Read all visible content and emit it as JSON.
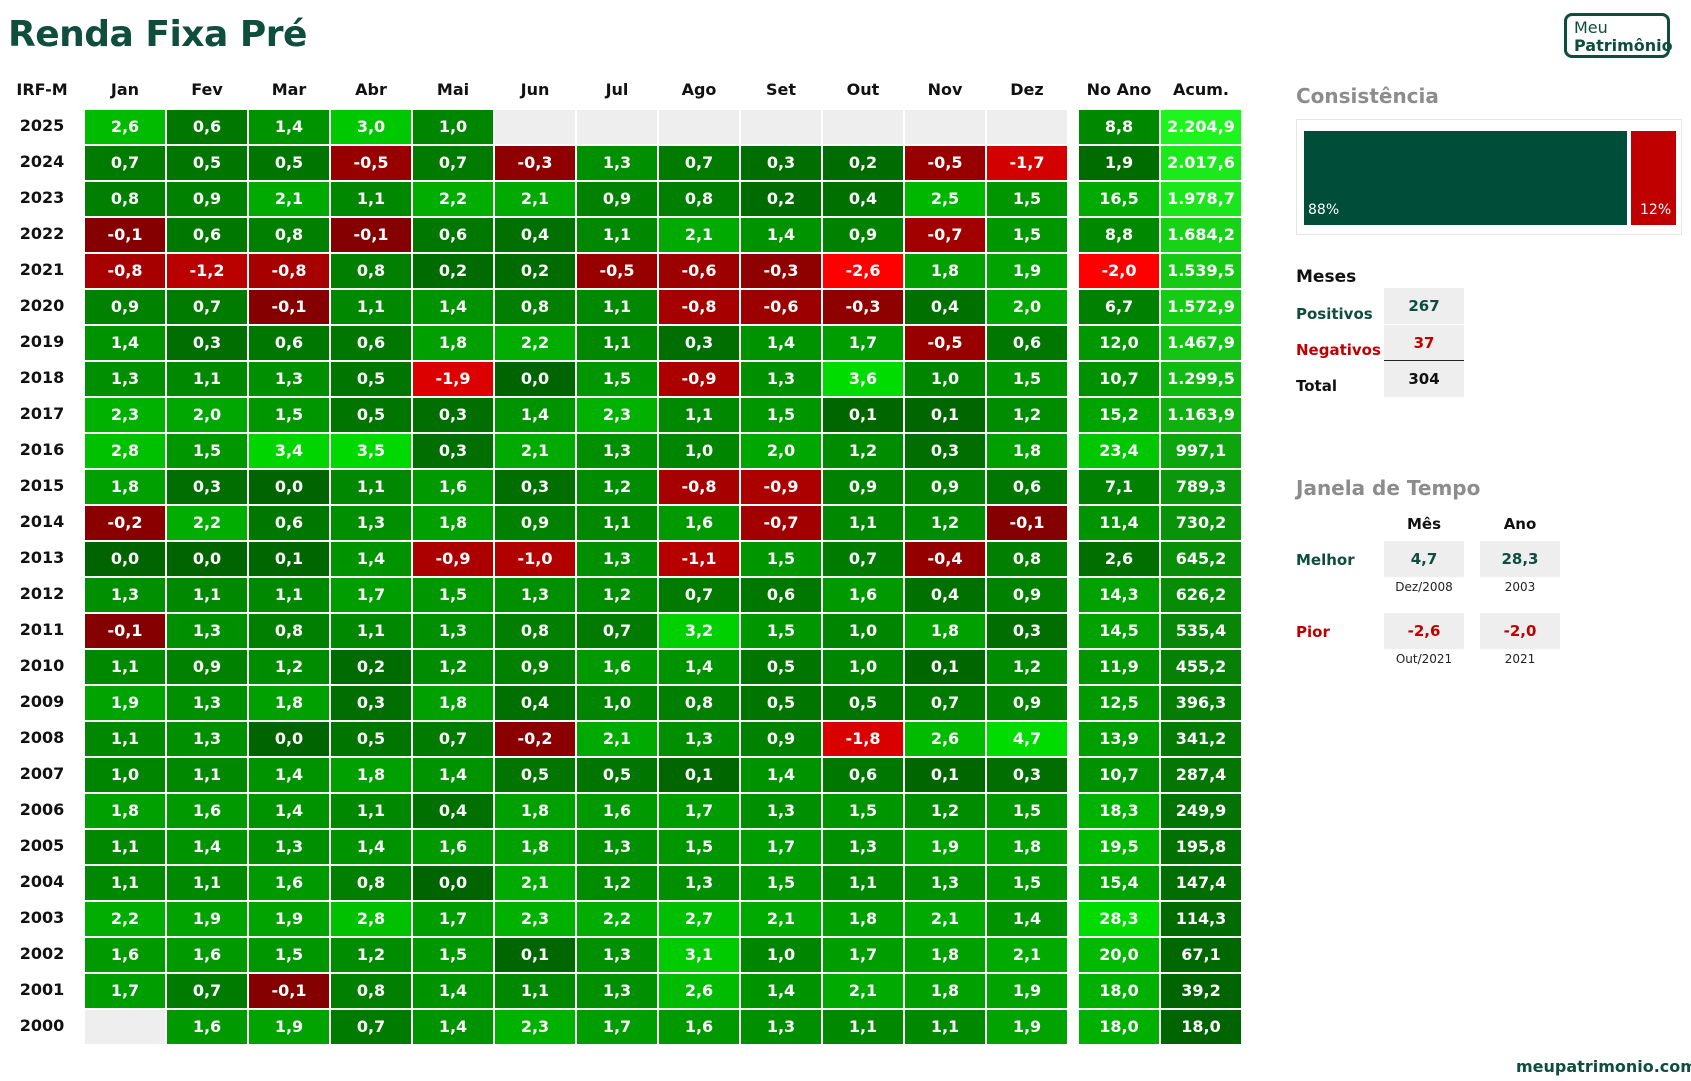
{
  "title": "Renda Fixa Pré",
  "logo": {
    "line1": "Meu",
    "line2": "Patrimônio"
  },
  "footer": "meupatrimonio.com",
  "colors": {
    "brand": "#0f4d3c",
    "positive": "#004d3a",
    "negative": "#c00000"
  },
  "chart_data": {
    "type": "heatmap",
    "row_header": "IRF-M",
    "months": [
      "Jan",
      "Fev",
      "Mar",
      "Abr",
      "Mai",
      "Jun",
      "Jul",
      "Ago",
      "Set",
      "Out",
      "Nov",
      "Dez"
    ],
    "year_col": "No Ano",
    "acc_col": "Acum.",
    "rows": [
      {
        "year": "2025",
        "m": [
          "2,6",
          "0,6",
          "1,4",
          "3,0",
          "1,0",
          "",
          "",
          "",
          "",
          "",
          "",
          ""
        ],
        "ano": "8,8",
        "acum": "2.204,9"
      },
      {
        "year": "2024",
        "m": [
          "0,7",
          "0,5",
          "0,5",
          "-0,5",
          "0,7",
          "-0,3",
          "1,3",
          "0,7",
          "0,3",
          "0,2",
          "-0,5",
          "-1,7"
        ],
        "ano": "1,9",
        "acum": "2.017,6"
      },
      {
        "year": "2023",
        "m": [
          "0,8",
          "0,9",
          "2,1",
          "1,1",
          "2,2",
          "2,1",
          "0,9",
          "0,8",
          "0,2",
          "0,4",
          "2,5",
          "1,5"
        ],
        "ano": "16,5",
        "acum": "1.978,7"
      },
      {
        "year": "2022",
        "m": [
          "-0,1",
          "0,6",
          "0,8",
          "-0,1",
          "0,6",
          "0,4",
          "1,1",
          "2,1",
          "1,4",
          "0,9",
          "-0,7",
          "1,5"
        ],
        "ano": "8,8",
        "acum": "1.684,2"
      },
      {
        "year": "2021",
        "m": [
          "-0,8",
          "-1,2",
          "-0,8",
          "0,8",
          "0,2",
          "0,2",
          "-0,5",
          "-0,6",
          "-0,3",
          "-2,6",
          "1,8",
          "1,9"
        ],
        "ano": "-2,0",
        "acum": "1.539,5"
      },
      {
        "year": "2020",
        "m": [
          "0,9",
          "0,7",
          "-0,1",
          "1,1",
          "1,4",
          "0,8",
          "1,1",
          "-0,8",
          "-0,6",
          "-0,3",
          "0,4",
          "2,0"
        ],
        "ano": "6,7",
        "acum": "1.572,9"
      },
      {
        "year": "2019",
        "m": [
          "1,4",
          "0,3",
          "0,6",
          "0,6",
          "1,8",
          "2,2",
          "1,1",
          "0,3",
          "1,4",
          "1,7",
          "-0,5",
          "0,6"
        ],
        "ano": "12,0",
        "acum": "1.467,9"
      },
      {
        "year": "2018",
        "m": [
          "1,3",
          "1,1",
          "1,3",
          "0,5",
          "-1,9",
          "0,0",
          "1,5",
          "-0,9",
          "1,3",
          "3,6",
          "1,0",
          "1,5"
        ],
        "ano": "10,7",
        "acum": "1.299,5"
      },
      {
        "year": "2017",
        "m": [
          "2,3",
          "2,0",
          "1,5",
          "0,5",
          "0,3",
          "1,4",
          "2,3",
          "1,1",
          "1,5",
          "0,1",
          "0,1",
          "1,2"
        ],
        "ano": "15,2",
        "acum": "1.163,9"
      },
      {
        "year": "2016",
        "m": [
          "2,8",
          "1,5",
          "3,4",
          "3,5",
          "0,3",
          "2,1",
          "1,3",
          "1,0",
          "2,0",
          "1,2",
          "0,3",
          "1,8"
        ],
        "ano": "23,4",
        "acum": "997,1"
      },
      {
        "year": "2015",
        "m": [
          "1,8",
          "0,3",
          "0,0",
          "1,1",
          "1,6",
          "0,3",
          "1,2",
          "-0,8",
          "-0,9",
          "0,9",
          "0,9",
          "0,6"
        ],
        "ano": "7,1",
        "acum": "789,3"
      },
      {
        "year": "2014",
        "m": [
          "-0,2",
          "2,2",
          "0,6",
          "1,3",
          "1,8",
          "0,9",
          "1,1",
          "1,6",
          "-0,7",
          "1,1",
          "1,2",
          "-0,1"
        ],
        "ano": "11,4",
        "acum": "730,2"
      },
      {
        "year": "2013",
        "m": [
          "0,0",
          "0,0",
          "0,1",
          "1,4",
          "-0,9",
          "-1,0",
          "1,3",
          "-1,1",
          "1,5",
          "0,7",
          "-0,4",
          "0,8"
        ],
        "ano": "2,6",
        "acum": "645,2"
      },
      {
        "year": "2012",
        "m": [
          "1,3",
          "1,1",
          "1,1",
          "1,7",
          "1,5",
          "1,3",
          "1,2",
          "0,7",
          "0,6",
          "1,6",
          "0,4",
          "0,9"
        ],
        "ano": "14,3",
        "acum": "626,2"
      },
      {
        "year": "2011",
        "m": [
          "-0,1",
          "1,3",
          "0,8",
          "1,1",
          "1,3",
          "0,8",
          "0,7",
          "3,2",
          "1,5",
          "1,0",
          "1,8",
          "0,3"
        ],
        "ano": "14,5",
        "acum": "535,4"
      },
      {
        "year": "2010",
        "m": [
          "1,1",
          "0,9",
          "1,2",
          "0,2",
          "1,2",
          "0,9",
          "1,6",
          "1,4",
          "0,5",
          "1,0",
          "0,1",
          "1,2"
        ],
        "ano": "11,9",
        "acum": "455,2"
      },
      {
        "year": "2009",
        "m": [
          "1,9",
          "1,3",
          "1,8",
          "0,3",
          "1,8",
          "0,4",
          "1,0",
          "0,8",
          "0,5",
          "0,5",
          "0,7",
          "0,9"
        ],
        "ano": "12,5",
        "acum": "396,3"
      },
      {
        "year": "2008",
        "m": [
          "1,1",
          "1,3",
          "0,0",
          "0,5",
          "0,7",
          "-0,2",
          "2,1",
          "1,3",
          "0,9",
          "-1,8",
          "2,6",
          "4,7"
        ],
        "ano": "13,9",
        "acum": "341,2"
      },
      {
        "year": "2007",
        "m": [
          "1,0",
          "1,1",
          "1,4",
          "1,8",
          "1,4",
          "0,5",
          "0,5",
          "0,1",
          "1,4",
          "0,6",
          "0,1",
          "0,3"
        ],
        "ano": "10,7",
        "acum": "287,4"
      },
      {
        "year": "2006",
        "m": [
          "1,8",
          "1,6",
          "1,4",
          "1,1",
          "0,4",
          "1,8",
          "1,6",
          "1,7",
          "1,3",
          "1,5",
          "1,2",
          "1,5"
        ],
        "ano": "18,3",
        "acum": "249,9"
      },
      {
        "year": "2005",
        "m": [
          "1,1",
          "1,4",
          "1,3",
          "1,4",
          "1,6",
          "1,8",
          "1,3",
          "1,5",
          "1,7",
          "1,3",
          "1,9",
          "1,8"
        ],
        "ano": "19,5",
        "acum": "195,8"
      },
      {
        "year": "2004",
        "m": [
          "1,1",
          "1,1",
          "1,6",
          "0,8",
          "0,0",
          "2,1",
          "1,2",
          "1,3",
          "1,5",
          "1,1",
          "1,3",
          "1,5"
        ],
        "ano": "15,4",
        "acum": "147,4"
      },
      {
        "year": "2003",
        "m": [
          "2,2",
          "1,9",
          "1,9",
          "2,8",
          "1,7",
          "2,3",
          "2,2",
          "2,7",
          "2,1",
          "1,8",
          "2,1",
          "1,4"
        ],
        "ano": "28,3",
        "acum": "114,3"
      },
      {
        "year": "2002",
        "m": [
          "1,6",
          "1,6",
          "1,5",
          "1,2",
          "1,5",
          "0,1",
          "1,3",
          "3,1",
          "1,0",
          "1,7",
          "1,8",
          "2,1"
        ],
        "ano": "20,0",
        "acum": "67,1"
      },
      {
        "year": "2001",
        "m": [
          "1,7",
          "0,7",
          "-0,1",
          "0,8",
          "1,4",
          "1,1",
          "1,3",
          "2,6",
          "1,4",
          "2,1",
          "1,8",
          "1,9"
        ],
        "ano": "18,0",
        "acum": "39,2"
      },
      {
        "year": "2000",
        "m": [
          "",
          "1,6",
          "1,9",
          "0,7",
          "1,4",
          "2,3",
          "1,7",
          "1,6",
          "1,3",
          "1,1",
          "1,1",
          "1,9"
        ],
        "ano": "18,0",
        "acum": "18,0"
      }
    ]
  },
  "consistencia": {
    "title": "Consistência",
    "positive_pct": 88,
    "positive_label": "88%",
    "negative_pct": 12,
    "negative_label": "12%"
  },
  "meses": {
    "title": "Meses",
    "positivos_label": "Positivos",
    "positivos": "267",
    "negativos_label": "Negativos",
    "negativos": "37",
    "total_label": "Total",
    "total": "304"
  },
  "janela": {
    "title": "Janela de Tempo",
    "col_mes": "Mês",
    "col_ano": "Ano",
    "melhor_label": "Melhor",
    "melhor_mes": "4,7",
    "melhor_mes_sub": "Dez/2008",
    "melhor_ano": "28,3",
    "melhor_ano_sub": "2003",
    "pior_label": "Pior",
    "pior_mes": "-2,6",
    "pior_mes_sub": "Out/2021",
    "pior_ano": "-2,0",
    "pior_ano_sub": "2021"
  }
}
